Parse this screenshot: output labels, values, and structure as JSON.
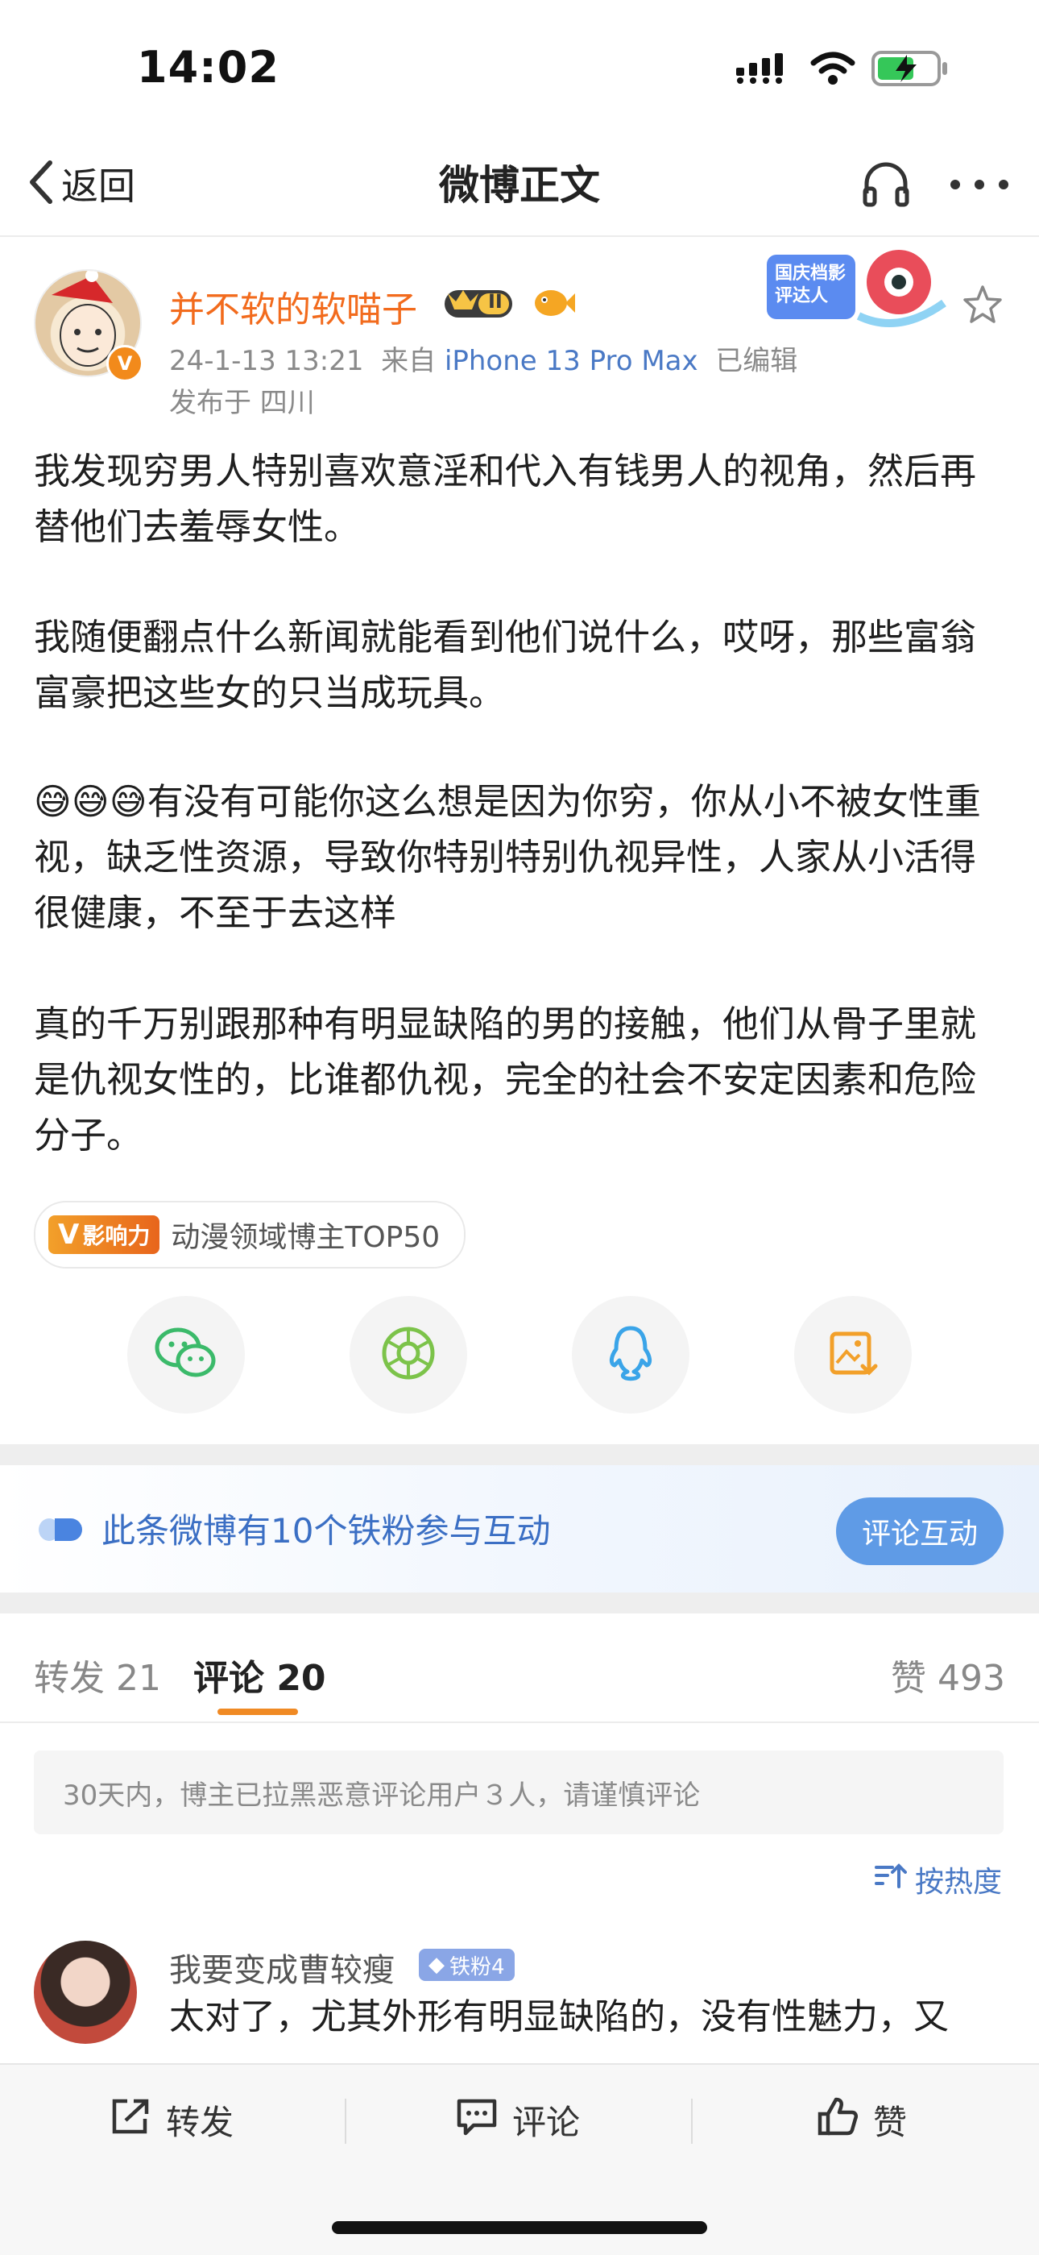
{
  "status_bar": {
    "time": "14:02"
  },
  "nav": {
    "back_label": "返回",
    "title": "微博正文"
  },
  "author": {
    "name": "并不软的软喵子",
    "level_badge": "II",
    "timestamp": "24-1-13 13:21",
    "source_prefix": "来自",
    "device": "iPhone 13 Pro Max",
    "edited": "已编辑",
    "location": "发布于 四川",
    "event_badge": "国庆档影评达人"
  },
  "post": {
    "paragraphs": [
      "我发现穷男人特别喜欢意淫和代入有钱男人的视角，然后再替他们去羞辱女性。",
      "我随便翻点什么新闻就能看到他们说什么，哎呀，那些富翁富豪把这些女的只当成玩具。",
      "😅😅😅有没有可能你这么想是因为你穷，你从小不被女性重视，缺乏性资源，导致你特别特别仇视异性，人家从小活得很健康，不至于去这样",
      "真的千万别跟那种有明显缺陷的男的接触，他们从骨子里就是仇视女性的，比谁都仇视，完全的社会不安定因素和危险分子。"
    ],
    "influence_tag": "影响力",
    "influence_text": "动漫领域博主TOP50"
  },
  "share": {
    "icons": [
      "wechat-icon",
      "moments-icon",
      "qq-icon",
      "save-image-icon"
    ]
  },
  "fans": {
    "text": "此条微博有10个铁粉参与互动",
    "button": "评论互动"
  },
  "tabs": {
    "repost": "转发 21",
    "comment": "评论 20",
    "like": "赞 493"
  },
  "notice": "30天内，博主已拉黑恶意评论用户３人，请谨慎评论",
  "sort_label": "按热度",
  "comment": {
    "name": "我要变成曹较瘦",
    "badge": "铁粉4",
    "text": "太对了，尤其外形有明显缺陷的，没有性魅力，又"
  },
  "bottom_bar": {
    "repost": "转发",
    "comment": "评论",
    "like": "赞"
  },
  "colors": {
    "accent_orange": "#f26b1d",
    "link_blue": "#4a79c5",
    "button_blue": "#5f9be6"
  }
}
